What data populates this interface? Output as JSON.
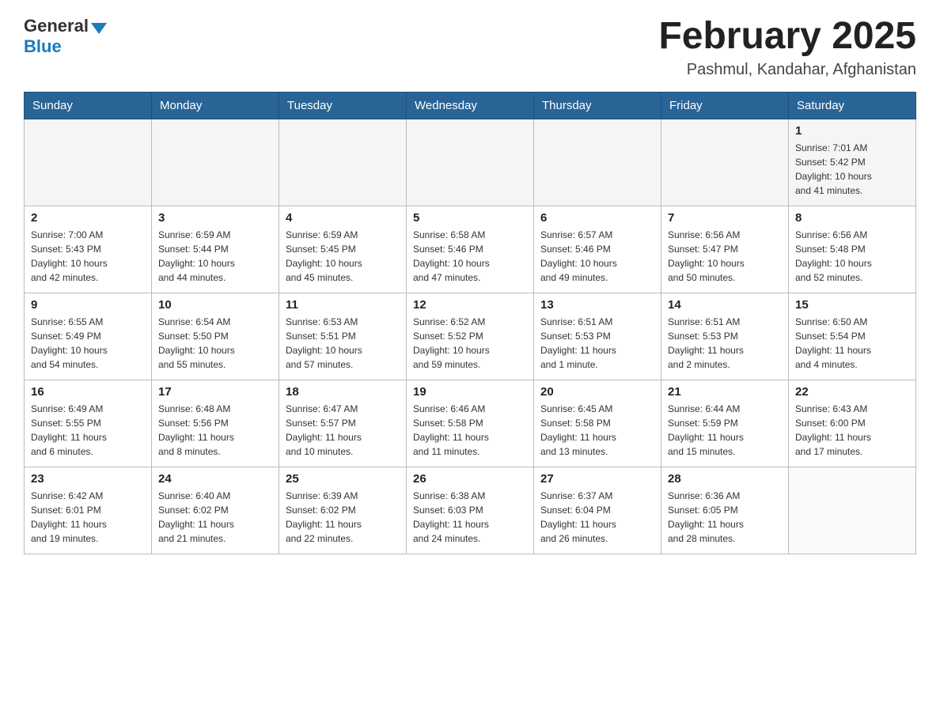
{
  "header": {
    "logo_general": "General",
    "logo_blue": "Blue",
    "month_title": "February 2025",
    "location": "Pashmul, Kandahar, Afghanistan"
  },
  "weekdays": [
    "Sunday",
    "Monday",
    "Tuesday",
    "Wednesday",
    "Thursday",
    "Friday",
    "Saturday"
  ],
  "weeks": [
    [
      {
        "day": "",
        "info": ""
      },
      {
        "day": "",
        "info": ""
      },
      {
        "day": "",
        "info": ""
      },
      {
        "day": "",
        "info": ""
      },
      {
        "day": "",
        "info": ""
      },
      {
        "day": "",
        "info": ""
      },
      {
        "day": "1",
        "info": "Sunrise: 7:01 AM\nSunset: 5:42 PM\nDaylight: 10 hours\nand 41 minutes."
      }
    ],
    [
      {
        "day": "2",
        "info": "Sunrise: 7:00 AM\nSunset: 5:43 PM\nDaylight: 10 hours\nand 42 minutes."
      },
      {
        "day": "3",
        "info": "Sunrise: 6:59 AM\nSunset: 5:44 PM\nDaylight: 10 hours\nand 44 minutes."
      },
      {
        "day": "4",
        "info": "Sunrise: 6:59 AM\nSunset: 5:45 PM\nDaylight: 10 hours\nand 45 minutes."
      },
      {
        "day": "5",
        "info": "Sunrise: 6:58 AM\nSunset: 5:46 PM\nDaylight: 10 hours\nand 47 minutes."
      },
      {
        "day": "6",
        "info": "Sunrise: 6:57 AM\nSunset: 5:46 PM\nDaylight: 10 hours\nand 49 minutes."
      },
      {
        "day": "7",
        "info": "Sunrise: 6:56 AM\nSunset: 5:47 PM\nDaylight: 10 hours\nand 50 minutes."
      },
      {
        "day": "8",
        "info": "Sunrise: 6:56 AM\nSunset: 5:48 PM\nDaylight: 10 hours\nand 52 minutes."
      }
    ],
    [
      {
        "day": "9",
        "info": "Sunrise: 6:55 AM\nSunset: 5:49 PM\nDaylight: 10 hours\nand 54 minutes."
      },
      {
        "day": "10",
        "info": "Sunrise: 6:54 AM\nSunset: 5:50 PM\nDaylight: 10 hours\nand 55 minutes."
      },
      {
        "day": "11",
        "info": "Sunrise: 6:53 AM\nSunset: 5:51 PM\nDaylight: 10 hours\nand 57 minutes."
      },
      {
        "day": "12",
        "info": "Sunrise: 6:52 AM\nSunset: 5:52 PM\nDaylight: 10 hours\nand 59 minutes."
      },
      {
        "day": "13",
        "info": "Sunrise: 6:51 AM\nSunset: 5:53 PM\nDaylight: 11 hours\nand 1 minute."
      },
      {
        "day": "14",
        "info": "Sunrise: 6:51 AM\nSunset: 5:53 PM\nDaylight: 11 hours\nand 2 minutes."
      },
      {
        "day": "15",
        "info": "Sunrise: 6:50 AM\nSunset: 5:54 PM\nDaylight: 11 hours\nand 4 minutes."
      }
    ],
    [
      {
        "day": "16",
        "info": "Sunrise: 6:49 AM\nSunset: 5:55 PM\nDaylight: 11 hours\nand 6 minutes."
      },
      {
        "day": "17",
        "info": "Sunrise: 6:48 AM\nSunset: 5:56 PM\nDaylight: 11 hours\nand 8 minutes."
      },
      {
        "day": "18",
        "info": "Sunrise: 6:47 AM\nSunset: 5:57 PM\nDaylight: 11 hours\nand 10 minutes."
      },
      {
        "day": "19",
        "info": "Sunrise: 6:46 AM\nSunset: 5:58 PM\nDaylight: 11 hours\nand 11 minutes."
      },
      {
        "day": "20",
        "info": "Sunrise: 6:45 AM\nSunset: 5:58 PM\nDaylight: 11 hours\nand 13 minutes."
      },
      {
        "day": "21",
        "info": "Sunrise: 6:44 AM\nSunset: 5:59 PM\nDaylight: 11 hours\nand 15 minutes."
      },
      {
        "day": "22",
        "info": "Sunrise: 6:43 AM\nSunset: 6:00 PM\nDaylight: 11 hours\nand 17 minutes."
      }
    ],
    [
      {
        "day": "23",
        "info": "Sunrise: 6:42 AM\nSunset: 6:01 PM\nDaylight: 11 hours\nand 19 minutes."
      },
      {
        "day": "24",
        "info": "Sunrise: 6:40 AM\nSunset: 6:02 PM\nDaylight: 11 hours\nand 21 minutes."
      },
      {
        "day": "25",
        "info": "Sunrise: 6:39 AM\nSunset: 6:02 PM\nDaylight: 11 hours\nand 22 minutes."
      },
      {
        "day": "26",
        "info": "Sunrise: 6:38 AM\nSunset: 6:03 PM\nDaylight: 11 hours\nand 24 minutes."
      },
      {
        "day": "27",
        "info": "Sunrise: 6:37 AM\nSunset: 6:04 PM\nDaylight: 11 hours\nand 26 minutes."
      },
      {
        "day": "28",
        "info": "Sunrise: 6:36 AM\nSunset: 6:05 PM\nDaylight: 11 hours\nand 28 minutes."
      },
      {
        "day": "",
        "info": ""
      }
    ]
  ]
}
